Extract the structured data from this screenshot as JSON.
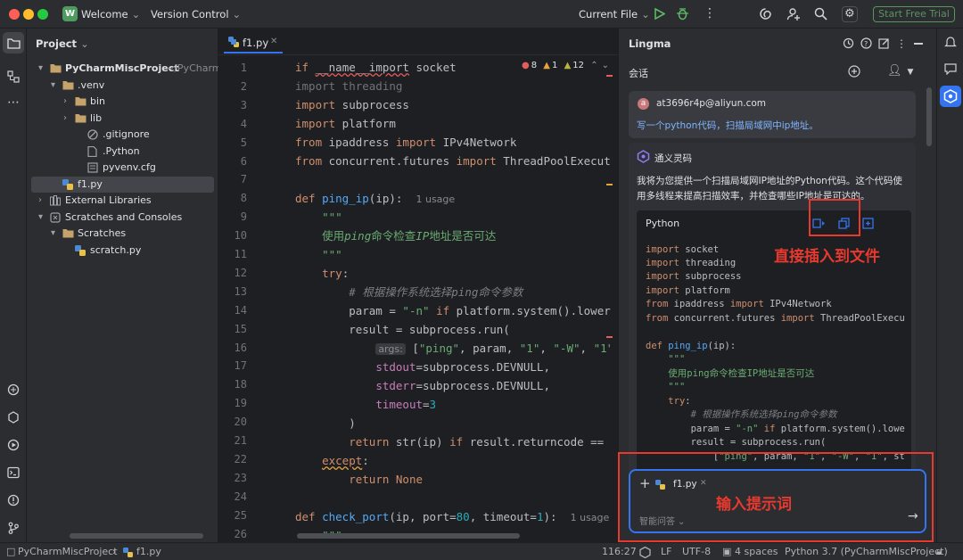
{
  "titlebar": {
    "project_badge": "W",
    "project_label": "Welcome",
    "vcs_label": "Version Control",
    "run_config": "Current File",
    "trial_button": "Start Free Trial"
  },
  "project": {
    "header": "Project",
    "tree": [
      {
        "label": "PyCharmMiscProject",
        "suffix": "~/PyCharmMi",
        "indent": 0,
        "arrow": "▾",
        "icon": "folder"
      },
      {
        "label": ".venv",
        "indent": 1,
        "arrow": "▾",
        "icon": "folder"
      },
      {
        "label": "bin",
        "indent": 2,
        "arrow": "›",
        "icon": "folder"
      },
      {
        "label": "lib",
        "indent": 2,
        "arrow": "›",
        "icon": "folder"
      },
      {
        "label": ".gitignore",
        "indent": 3,
        "arrow": "",
        "icon": "gitignore"
      },
      {
        "label": ".Python",
        "indent": 3,
        "arrow": "",
        "icon": "file"
      },
      {
        "label": "pyvenv.cfg",
        "indent": 3,
        "arrow": "",
        "icon": "cfg"
      },
      {
        "label": "f1.py",
        "indent": 1,
        "arrow": "",
        "icon": "py",
        "selected": true
      },
      {
        "label": "External Libraries",
        "indent": 0,
        "arrow": "›",
        "icon": "lib"
      },
      {
        "label": "Scratches and Consoles",
        "indent": 0,
        "arrow": "▾",
        "icon": "scratch"
      },
      {
        "label": "Scratches",
        "indent": 1,
        "arrow": "▾",
        "icon": "folder"
      },
      {
        "label": "scratch.py",
        "indent": 2,
        "arrow": "",
        "icon": "py"
      }
    ]
  },
  "editor": {
    "tab": "f1.py",
    "inspections": {
      "errors": "8",
      "warnings": "1",
      "weak": "12"
    },
    "line_numbers": [
      "1",
      "2",
      "3",
      "4",
      "5",
      "6",
      "7",
      "8",
      "9",
      "10",
      "11",
      "12",
      "13",
      "14",
      "15",
      "16",
      "17",
      "18",
      "19",
      "20",
      "21",
      "22",
      "23",
      "24",
      "25",
      "26"
    ],
    "usage_hint_1": "1 usage",
    "usage_hint_2": "1 usage",
    "args_hint": "args:"
  },
  "lingma": {
    "title": "Lingma",
    "tab_chat": "会话",
    "user_email": "at3696r4p@aliyun.com",
    "user_avatar": "a",
    "user_message": "写一个python代码，扫描局域网中ip地址。",
    "bot_name": "通义灵码",
    "bot_intro": "我将为您提供一个扫描局域网IP地址的Python代码。这个代码使用多线程来提高扫描效率，并检查哪些IP地址是可达的。",
    "code_lang": "Python",
    "annot_insert": "直接插入到文件",
    "annot_input": "输入提示词",
    "input_file_chip": "f1.py",
    "input_mode": "智能问答"
  },
  "statusbar": {
    "breadcrumb_project": "PyCharmMiscProject",
    "breadcrumb_file": "f1.py",
    "position": "116:27",
    "line_sep": "LF",
    "encoding": "UTF-8",
    "indent": "4 spaces",
    "interpreter": "Python 3.7 (PyCharmMiscProject)"
  }
}
